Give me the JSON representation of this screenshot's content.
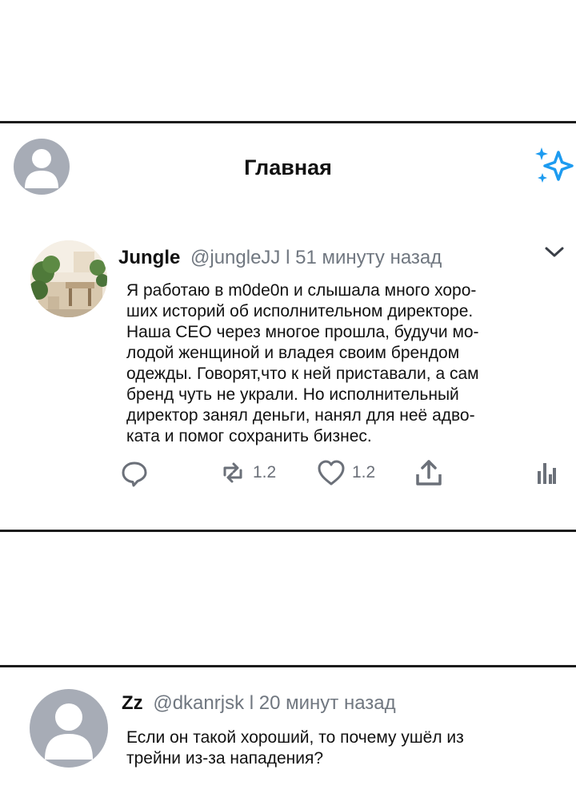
{
  "header": {
    "title": "Главная",
    "sparkle_color": "#1d9bf0"
  },
  "tweet1": {
    "name": "Jungle",
    "handle": "@jungleJJ",
    "separator": "l",
    "time": "51 минуту назад",
    "text_lines": [
      "Я работаю в m0de0n и слышала много хоро-",
      "ших историй об исполнительном директоре.",
      "Наша CEO через многое прошла, будучи мо-",
      "лодой женщиной и владея своим брендом",
      "одежды. Говорят,что к ней приставали, а сам",
      "бренд чуть не украли. Но исполнительный",
      "директор занял деньги, нанял для неё адво-",
      "ката и помог сохранить бизнес."
    ],
    "retweet_count": "1.2",
    "like_count": "1.2"
  },
  "tweet2": {
    "name": "Zz",
    "handle": "@dkanrjsk",
    "separator": "l",
    "time": "20 минут назад",
    "text_lines": [
      "Если он такой хороший, то почему ушёл из",
      "трейни из-за нападения?"
    ]
  },
  "icons": {
    "reply": "reply-icon",
    "retweet": "retweet-icon",
    "like": "heart-icon",
    "share": "share-icon",
    "analytics": "analytics-icon",
    "more": "chevron-down-icon"
  }
}
